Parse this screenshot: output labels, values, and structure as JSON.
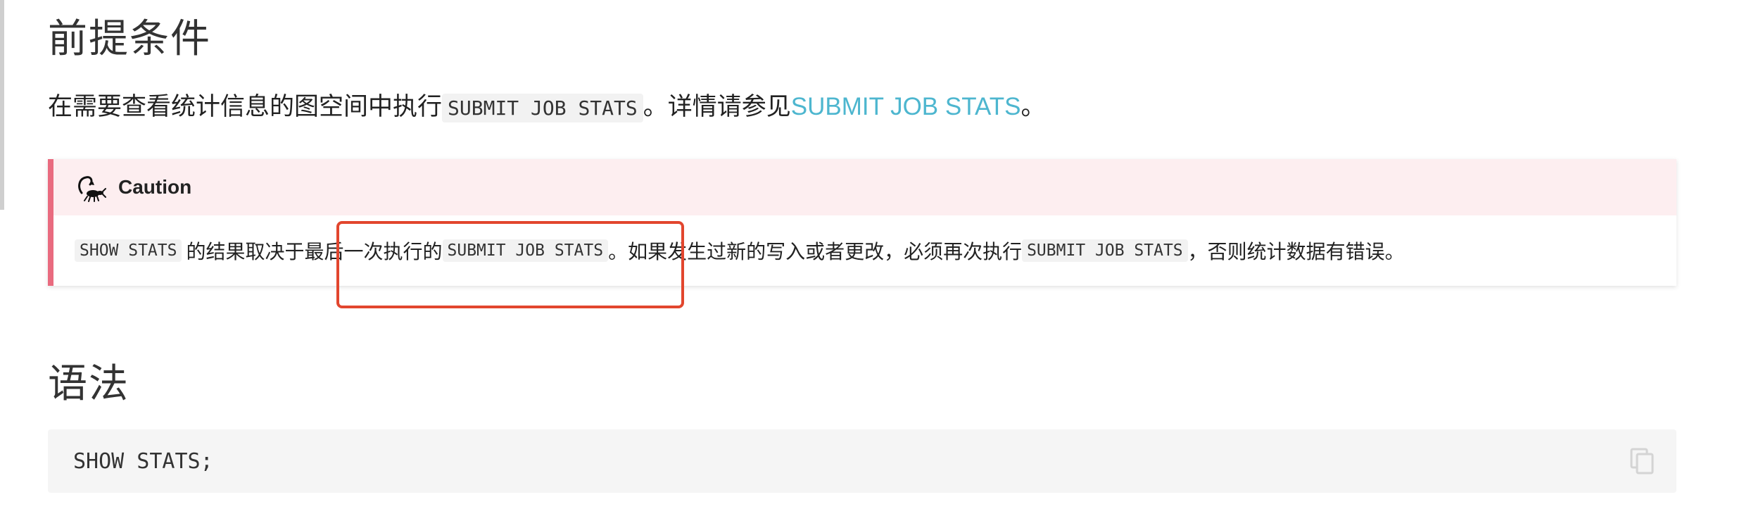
{
  "sections": {
    "prereq_title": "前提条件",
    "syntax_title": "语法"
  },
  "intro": {
    "text_before": "在需要查看统计信息的图空间中执行",
    "code": "SUBMIT JOB STATS",
    "text_middle": "。详情请参见",
    "link_text": "SUBMIT JOB STATS",
    "text_after": "。"
  },
  "caution": {
    "icon": "scorpion-icon",
    "title": "Caution",
    "code1": "SHOW STATS",
    "text1": "的结果取决于最后一次执行的",
    "code2": "SUBMIT JOB STATS",
    "text2": "。如果发生过新的写入或者更改，必须再次执行",
    "code3": "SUBMIT JOB STATS",
    "text3": "，否则统计数据有错误。",
    "accent_color": "#e96b7f",
    "header_bg": "#fdeef0"
  },
  "codeblock": {
    "code": "SHOW STATS;",
    "copy_icon": "copy-icon"
  },
  "annotation": {
    "highlight_color": "#e2462e"
  }
}
